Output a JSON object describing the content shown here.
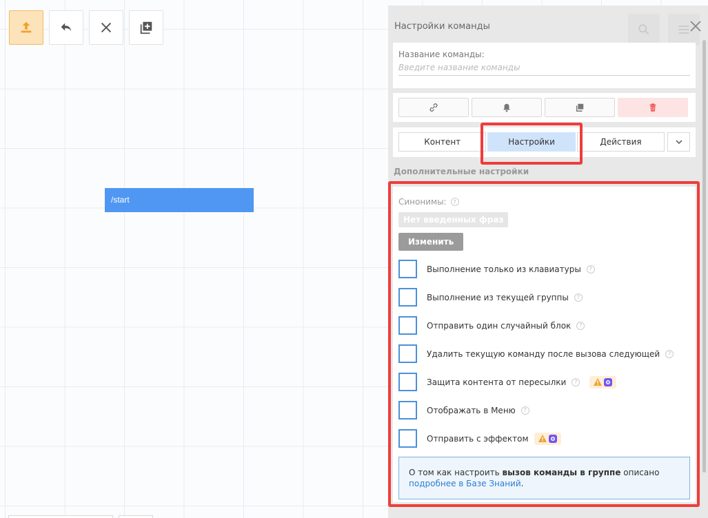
{
  "panel": {
    "title": "Настройки команды",
    "name_label": "Название команды:",
    "name_value": "",
    "name_placeholder": "Введите название команды"
  },
  "canvas": {
    "block_label": "/start"
  },
  "tabs": [
    {
      "label": "Контент"
    },
    {
      "label": "Настройки"
    },
    {
      "label": "Действия"
    }
  ],
  "section_title": "Дополнительные настройки",
  "synonyms": {
    "label": "Синонимы:",
    "empty_chip": "Нет введенных фраз",
    "edit_label": "Изменить"
  },
  "options": [
    {
      "label": "Выполнение только из клавиатуры"
    },
    {
      "label": "Выполнение из текущей группы"
    },
    {
      "label": "Отправить один случайный блок"
    },
    {
      "label": "Удалить текущую команду после вызова следующей"
    },
    {
      "label": "Защита контента от пересылки"
    },
    {
      "label": "Отображать в Меню"
    },
    {
      "label": "Отправить с эффектом"
    }
  ],
  "help_mark": "?",
  "info": {
    "prefix": "О том как настроить ",
    "bold": "вызов команды в группе",
    "middle": " описано",
    "link": "подробнее в Базе Знаний",
    "suffix": "."
  },
  "colors": {
    "accent": "#4f97f2",
    "highlight": "#ee3d3a",
    "active_tab": "#cfe3fb",
    "delete_bg": "#fde3e3"
  },
  "icons": {
    "toolbar": [
      "upload-icon",
      "undo-icon",
      "close-icon",
      "add-block-icon"
    ],
    "panel_actions": [
      "link-icon",
      "bell-icon",
      "copy-icon",
      "trash-icon"
    ]
  }
}
